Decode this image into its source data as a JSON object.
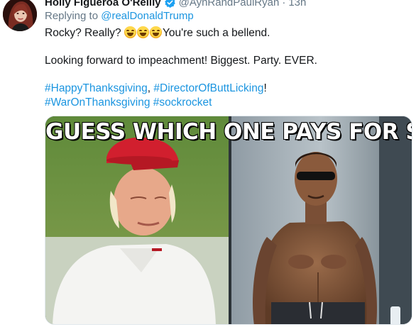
{
  "tweet": {
    "author_name": "Holly Figueroa O'Reilly",
    "author_handle": "@AynRandPaulRyan",
    "separator": "·",
    "timestamp": "13h",
    "reply_prefix": "Replying to",
    "reply_to": "@realDonaldTrump",
    "line1_before": "Rocky? Really?",
    "line1_after": "You're such a bellend.",
    "line2": "Looking forward to impeachment! Biggest. Party. EVER.",
    "hashtag1": "#HappyThanksgiving",
    "comma": ", ",
    "hashtag2": "#DirectorOfButtLicking",
    "exclaim": "!",
    "hashtag3": "#WarOnThanksgiving",
    "hashtag4": "#sockrocket",
    "emojis": [
      "face-with-tears-of-joy-icon",
      "face-with-tears-of-joy-icon",
      "face-with-tears-of-joy-icon"
    ]
  },
  "media": {
    "caption": "GUESS WHICH ONE PAYS FOR SEX"
  },
  "colors": {
    "link": "#1b95e0",
    "muted": "#657786",
    "verified": "#1da1f2",
    "cap_red": "#d11f2e"
  }
}
